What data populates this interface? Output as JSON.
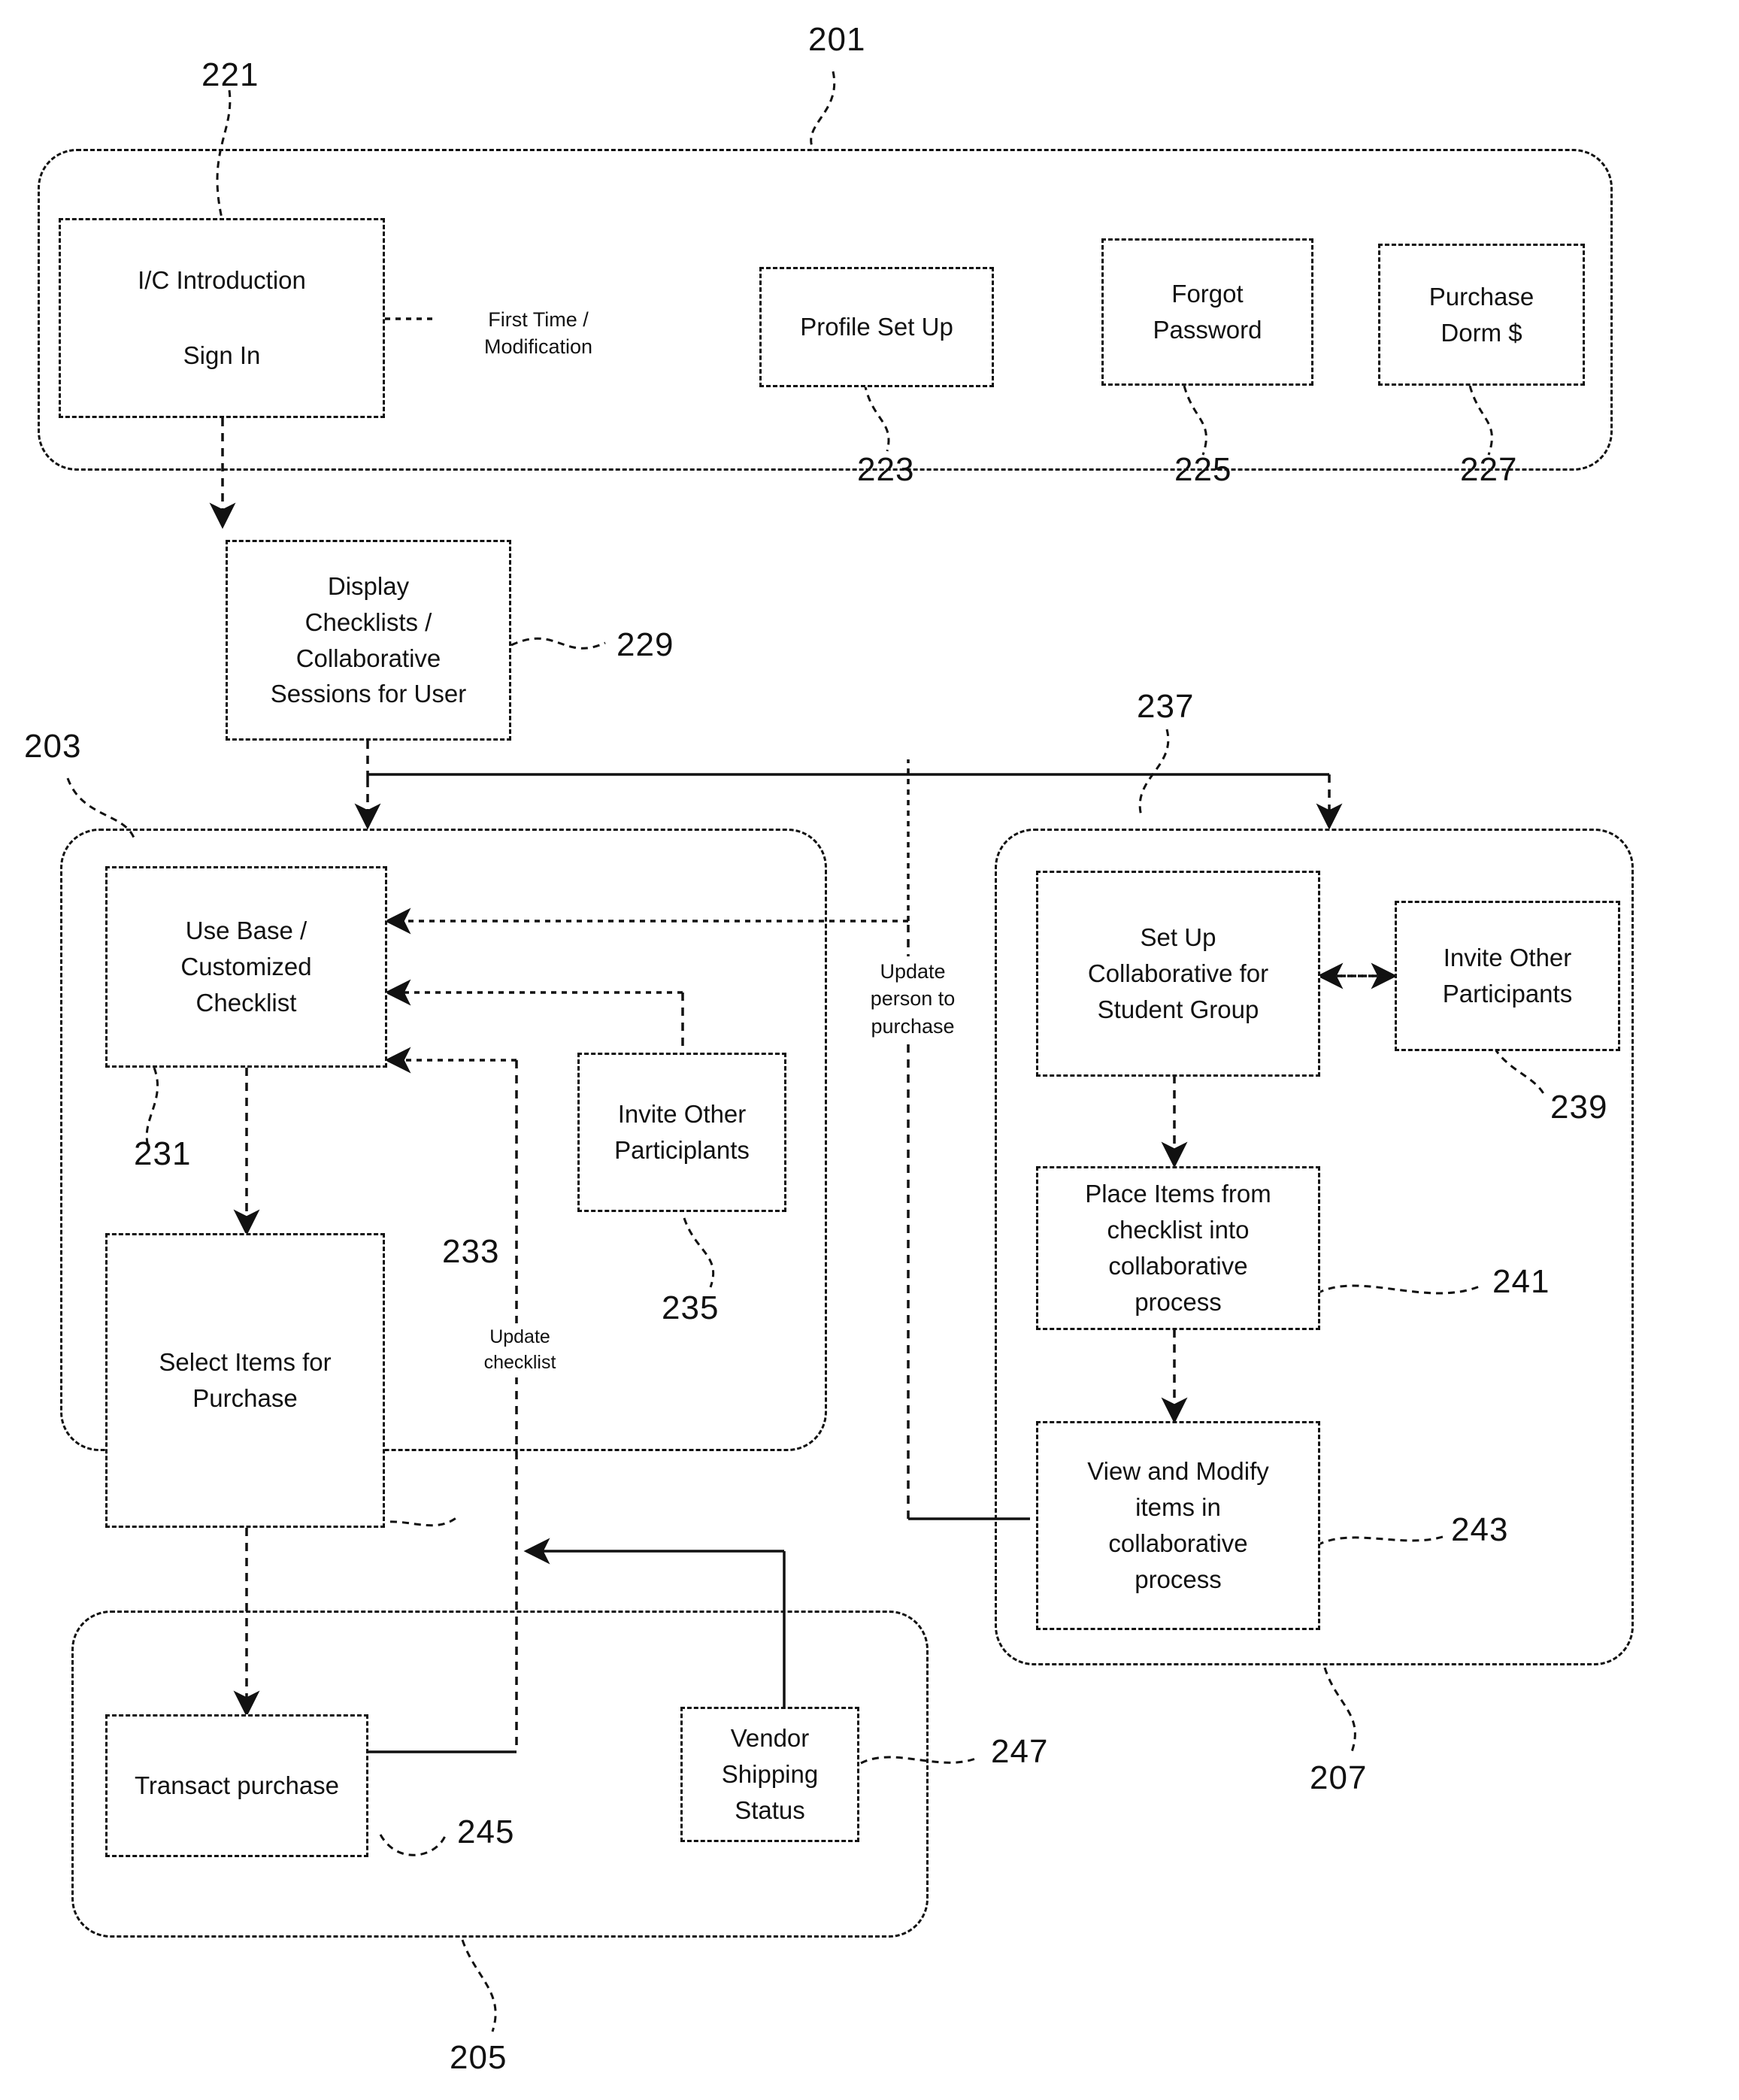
{
  "figure": {
    "title": "Process flow diagram",
    "line_color": "#111111",
    "background": "#ffffff"
  },
  "nodes": {
    "sign_in": {
      "line1": "I/C Introduction",
      "line2": "Sign In"
    },
    "profile_setup": {
      "label": "Profile Set Up"
    },
    "forgot_password": {
      "label": "Forgot\nPassword"
    },
    "purchase_dorm": {
      "label": "Purchase\nDorm $"
    },
    "display_checklists": {
      "label": "Display\nChecklists /\nCollaborative\nSessions for User"
    },
    "use_base_checklist": {
      "label": "Use Base /\nCustomized\nChecklist"
    },
    "select_items": {
      "label": "Select Items for\nPurchase"
    },
    "invite_participants_left": {
      "label": "Invite Other\nParticiplants"
    },
    "setup_collaborative": {
      "label": "Set Up\nCollaborative for\nStudent Group"
    },
    "invite_participants_right": {
      "label": "Invite Other\nParticipants"
    },
    "place_items": {
      "label": "Place Items from\nchecklist into\ncollaborative\nprocess"
    },
    "view_modify": {
      "label": "View and Modify\nitems in\ncollaborative\nprocess"
    },
    "transact_purchase": {
      "label": "Transact purchase"
    },
    "vendor_shipping": {
      "label": "Vendor\nShipping\nStatus"
    }
  },
  "edge_labels": {
    "first_time_modification": "First Time / Modification",
    "update_person_to_purchase": "Update\nperson to\npurchase",
    "update_checklist": "Update\nchecklist"
  },
  "reference_numerals": {
    "r201": "201",
    "r203": "203",
    "r205": "205",
    "r207": "207",
    "r221": "221",
    "r223": "223",
    "r225": "225",
    "r227": "227",
    "r229": "229",
    "r231": "231",
    "r233": "233",
    "r235": "235",
    "r237": "237",
    "r239": "239",
    "r241": "241",
    "r243": "243",
    "r245": "245",
    "r247": "247"
  }
}
